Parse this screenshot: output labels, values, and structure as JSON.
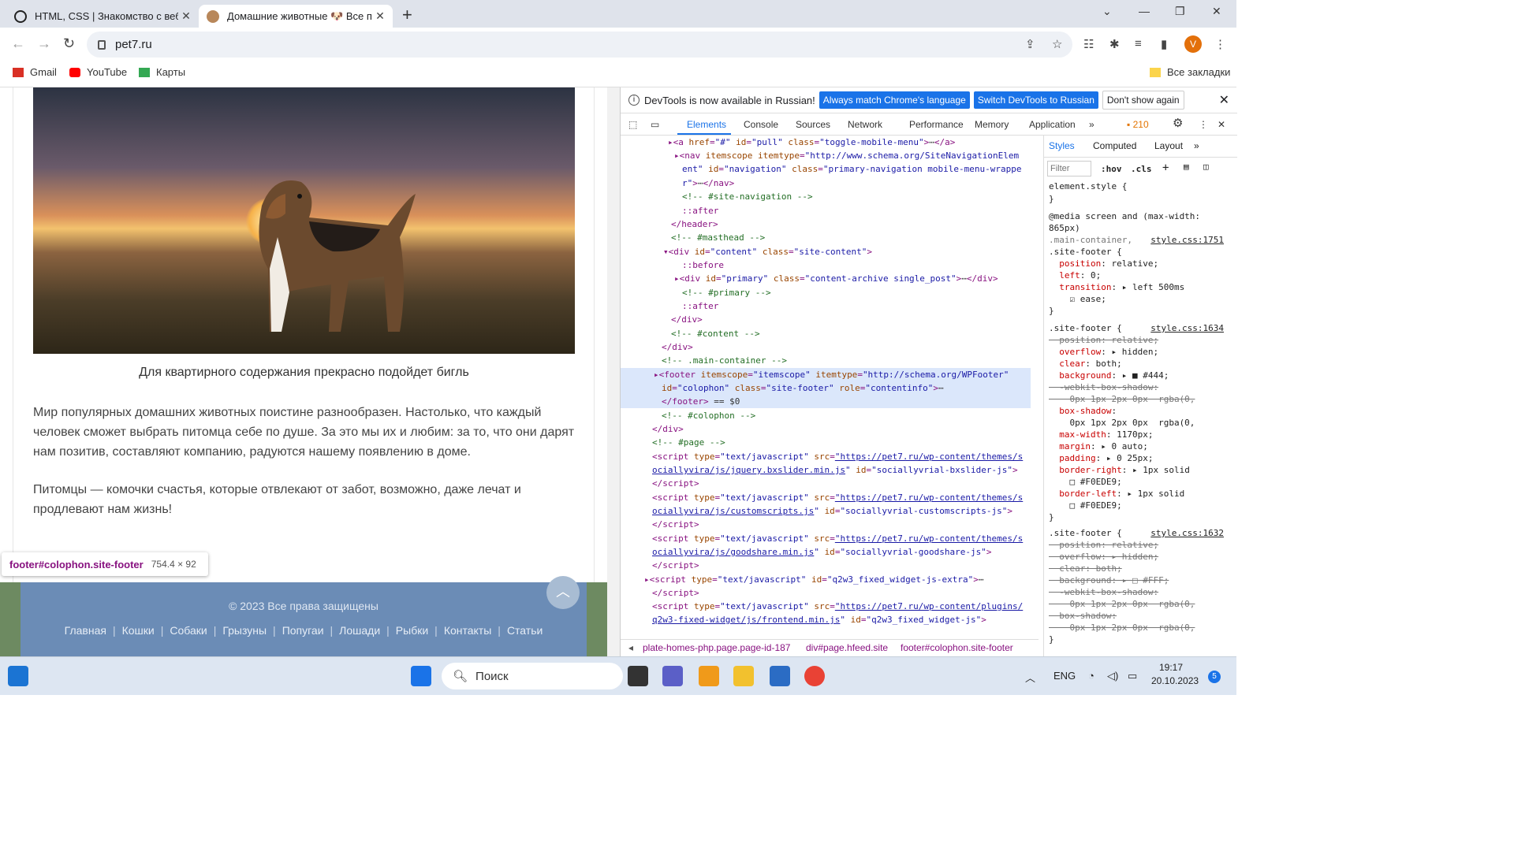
{
  "browser": {
    "tabs": [
      {
        "title": "HTML, CSS | Знакомство с веб-"
      },
      {
        "title": "Домашние животные 🐶 Все п"
      }
    ],
    "url": "pet7.ru",
    "avatar_letter": "V",
    "bookmarks": [
      "Gmail",
      "YouTube",
      "Карты"
    ],
    "all_bookmarks": "Все закладки"
  },
  "page": {
    "caption": "Для квартирного содержания прекрасно подойдет бигль",
    "para1": "Мир популярных домашних животных поистине разнообразен. Настолько, что каждый человек сможет выбрать питомца себе по душе. За это мы их и любим: за то, что они дарят нам позитив, составляют компанию, радуются нашему появлению в доме.",
    "para2": "Питомцы — комочки счастья, которые отвлекают от забот, возможно, даже лечат и продлевают нам жизнь!",
    "tooltip_selector": "footer#colophon.site-footer",
    "tooltip_size": "754.4 × 92",
    "copyright": "© 2023 Все права защищены",
    "footer_nav": [
      "Главная",
      "Кошки",
      "Собаки",
      "Грызуны",
      "Попугаи",
      "Лошади",
      "Рыбки",
      "Контакты",
      "Статьи"
    ]
  },
  "devtools": {
    "info_text": "DevTools is now available in Russian!",
    "btn_match": "Always match Chrome's language",
    "btn_switch": "Switch DevTools to Russian",
    "btn_dont": "Don't show again",
    "tabs": [
      "Elements",
      "Console",
      "Sources",
      "Network",
      "Performance",
      "Memory",
      "Application"
    ],
    "issues_count": "210",
    "styles_tabs": [
      "Styles",
      "Computed",
      "Layout"
    ],
    "filter_placeholder": "Filter",
    "hov": ":hov",
    "cls": ".cls",
    "breadcrumbs": [
      "plate-homes-php.page.page-id-187",
      "div#page.hfeed.site",
      "footer#colophon.site-footer"
    ]
  },
  "taskbar": {
    "search_placeholder": "Поиск",
    "lang": "ENG",
    "time": "19:17",
    "date": "20.10.2023",
    "notifications": "5"
  },
  "colors": {
    "accent": "#1a73e8",
    "footer_bg": "#6b8cb6",
    "footer_side": "#6d8a61"
  }
}
